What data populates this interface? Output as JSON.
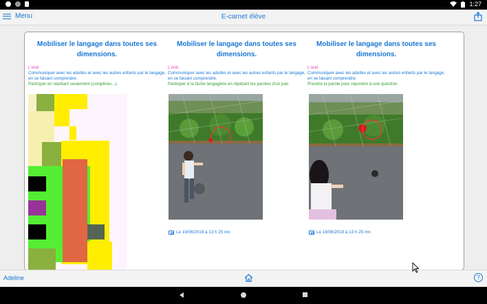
{
  "status_bar": {
    "time": "1:27"
  },
  "header": {
    "menu_label": "Menu",
    "title": "E-carnet élève"
  },
  "entries": [
    {
      "title": "Mobiliser le langage dans toutes ses dimensions.",
      "domain": "L'oral",
      "description": "Communiquer avec les adultes et avec les autres enfants par le langage, en se faisant comprendre.",
      "skill": "Participer en répétant seulement (comptines...).",
      "date": ""
    },
    {
      "title": "Mobiliser le langage dans toutes ses dimensions.",
      "domain": "L'oral",
      "description": "Communiquer avec les adultes et avec les autres enfants par le langage, en se faisant comprendre.",
      "skill": "Participer à la tâche langagière en répétant les paroles d'un pair.",
      "date": "Le 19/06/2019 à 13 h 25 mn"
    },
    {
      "title": "Mobiliser le langage dans toutes ses dimensions.",
      "domain": "L'oral",
      "description": "Communiquer avec les adultes et avec les autres enfants par le langage, en se faisant comprendre.",
      "skill": "Prendre la parole pour répondre à une question.",
      "date": "Le 19/06/2019 à 13 h 25 mn"
    }
  ],
  "footer": {
    "user_name": "Adeline",
    "help_label": "?"
  },
  "colors": {
    "accent": "#1976d2",
    "domain": "#e040c0",
    "skill": "#2e9e2e"
  }
}
